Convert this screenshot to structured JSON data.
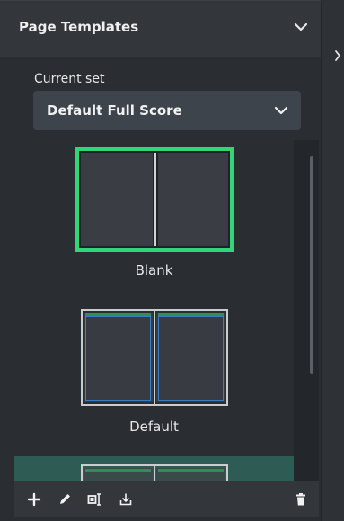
{
  "panel": {
    "title": "Page Templates"
  },
  "current_set": {
    "label": "Current set",
    "value": "Default Full Score"
  },
  "templates": [
    {
      "name": "Blank",
      "selected": true
    },
    {
      "name": "Default",
      "selected": false
    },
    {
      "name": "",
      "selected": false,
      "highlighted": true
    }
  ],
  "toolbar": {
    "icons": [
      "add-icon",
      "edit-pencil-icon",
      "rename-frame-icon",
      "import-icon",
      "delete-icon"
    ]
  },
  "colors": {
    "selection_border": "#31d67b",
    "highlight_row": "#2f5b55",
    "frame_blue": "#3c7cc4",
    "bar_green": "#2e8f5a"
  }
}
